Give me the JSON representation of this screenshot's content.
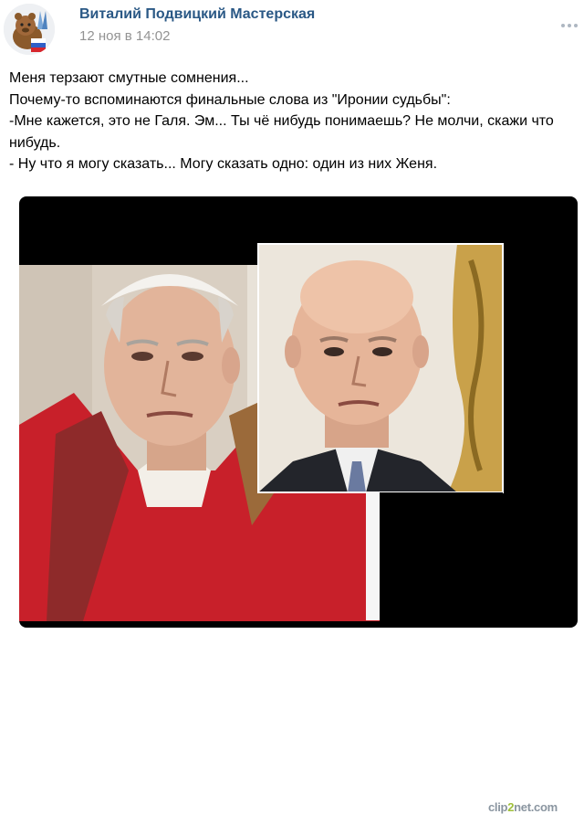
{
  "post": {
    "author": "Виталий Подвицкий Мастерская",
    "date": "12 ноя в 14:02",
    "more_icon": "ellipsis-icon",
    "avatar_icon": "avatar-icon",
    "text_lines": [
      "Меня терзают смутные сомнения...",
      "Почему-то вспоминаются финальные слова из \"Иронии судьбы\":",
      "-Мне кажется, это не Галя. Эм... Ты чё нибудь понимаешь? Не молчи, скажи что нибудь.",
      "- Ну что я могу сказать... Могу сказать одно: один из них Женя."
    ]
  },
  "photo": {
    "watermark_pre": "clip",
    "watermark_accent": "2",
    "watermark_post": "net.com"
  },
  "colors": {
    "link": "#2a5885",
    "muted": "#939393",
    "watermark": "#8a95a0",
    "watermark_accent": "#9fbf3a"
  }
}
